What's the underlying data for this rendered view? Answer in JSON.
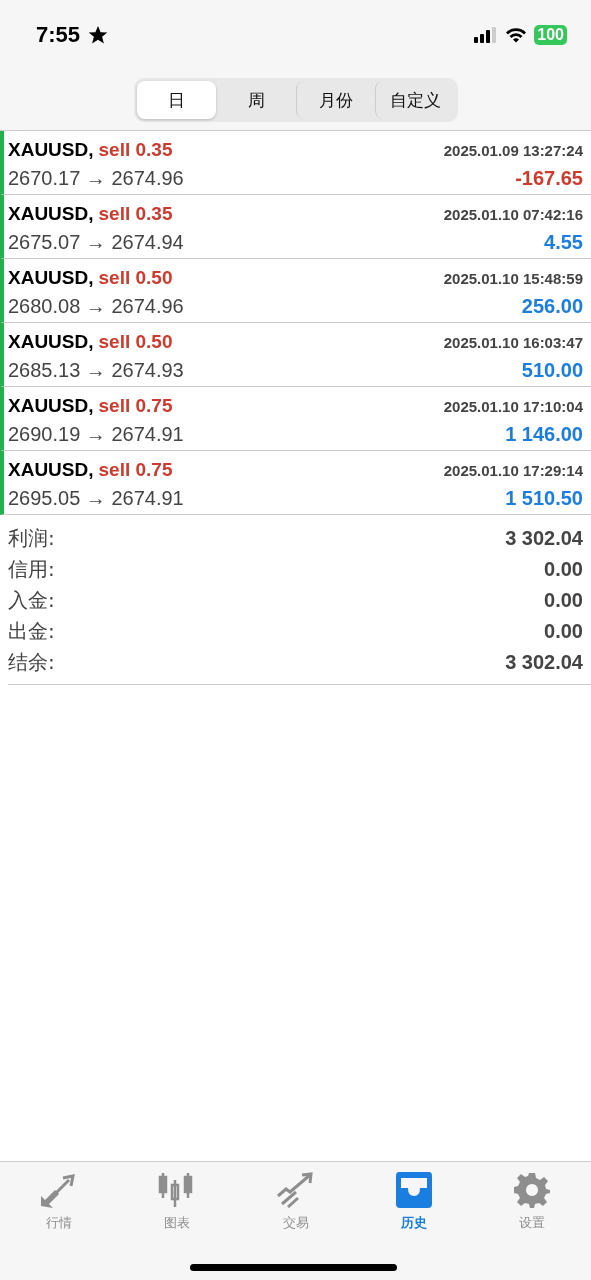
{
  "status_bar": {
    "time": "7:55",
    "battery": "100"
  },
  "period_tabs": [
    {
      "label": "日",
      "selected": true
    },
    {
      "label": "周",
      "selected": false
    },
    {
      "label": "月份",
      "selected": false
    },
    {
      "label": "自定义",
      "selected": false
    }
  ],
  "trades": [
    {
      "symbol": "XAUUSD,",
      "side": "sell 0.35",
      "time": "2025.01.09 13:27:24",
      "prices": "2670.17 → 2674.96",
      "profit": "-167.65",
      "kind": "loss"
    },
    {
      "symbol": "XAUUSD,",
      "side": "sell 0.35",
      "time": "2025.01.10 07:42:16",
      "prices": "2675.07 → 2674.94",
      "profit": "4.55",
      "kind": "gain"
    },
    {
      "symbol": "XAUUSD,",
      "side": "sell 0.50",
      "time": "2025.01.10 15:48:59",
      "prices": "2680.08 → 2674.96",
      "profit": "256.00",
      "kind": "gain"
    },
    {
      "symbol": "XAUUSD,",
      "side": "sell 0.50",
      "time": "2025.01.10 16:03:47",
      "prices": "2685.13 → 2674.93",
      "profit": "510.00",
      "kind": "gain"
    },
    {
      "symbol": "XAUUSD,",
      "side": "sell 0.75",
      "time": "2025.01.10 17:10:04",
      "prices": "2690.19 → 2674.91",
      "profit": "1 146.00",
      "kind": "gain"
    },
    {
      "symbol": "XAUUSD,",
      "side": "sell 0.75",
      "time": "2025.01.10 17:29:14",
      "prices": "2695.05 → 2674.91",
      "profit": "1 510.50",
      "kind": "gain"
    }
  ],
  "summary": [
    {
      "label": "利润:",
      "value": "3 302.04"
    },
    {
      "label": "信用:",
      "value": "0.00"
    },
    {
      "label": "入金:",
      "value": "0.00"
    },
    {
      "label": "出金:",
      "value": "0.00"
    },
    {
      "label": "结余:",
      "value": "3 302.04"
    }
  ],
  "bottom_tabs": [
    {
      "label": "行情",
      "kind": "quotes",
      "selected": false
    },
    {
      "label": "图表",
      "kind": "chart",
      "selected": false
    },
    {
      "label": "交易",
      "kind": "trade",
      "selected": false
    },
    {
      "label": "历史",
      "kind": "history",
      "selected": true
    },
    {
      "label": "设置",
      "kind": "settings",
      "selected": false
    }
  ]
}
